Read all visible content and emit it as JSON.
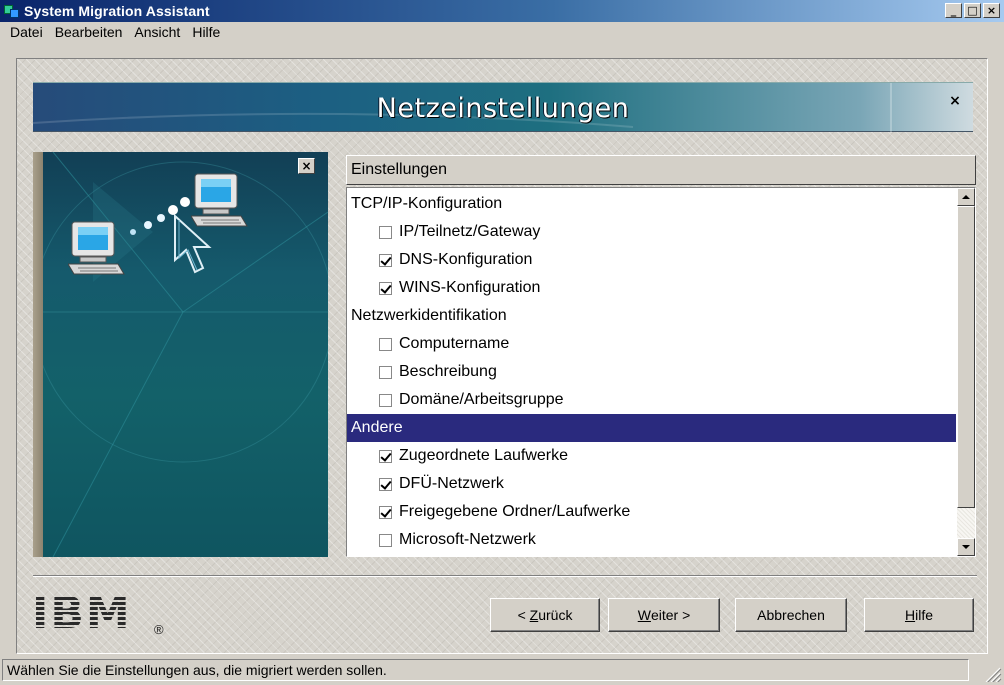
{
  "window": {
    "title": "System Migration Assistant",
    "controls": {
      "minimize": "_",
      "maximize": "□",
      "close": "×"
    }
  },
  "menu": [
    "Datei",
    "Bearbeiten",
    "Ansicht",
    "Hilfe"
  ],
  "banner": {
    "title": "Netzeinstellungen",
    "close": "×"
  },
  "side_panel": {
    "close": "×",
    "icons": [
      "computer-icon",
      "cursor-arrow-icon"
    ]
  },
  "settings": {
    "header": "Einstellungen",
    "groups": [
      {
        "label": "TCP/IP-Konfiguration",
        "selected": false,
        "items": [
          {
            "label": "IP/Teilnetz/Gateway",
            "checked": false
          },
          {
            "label": "DNS-Konfiguration",
            "checked": true
          },
          {
            "label": "WINS-Konfiguration",
            "checked": true
          }
        ]
      },
      {
        "label": "Netzwerkidentifikation",
        "selected": false,
        "items": [
          {
            "label": "Computername",
            "checked": false
          },
          {
            "label": "Beschreibung",
            "checked": false
          },
          {
            "label": "Domäne/Arbeitsgruppe",
            "checked": false
          }
        ]
      },
      {
        "label": "Andere",
        "selected": true,
        "items": [
          {
            "label": "Zugeordnete Laufwerke",
            "checked": true
          },
          {
            "label": "DFÜ-Netzwerk",
            "checked": true
          },
          {
            "label": "Freigegebene Ordner/Laufwerke",
            "checked": true
          },
          {
            "label": "Microsoft-Netzwerk",
            "checked": false
          }
        ]
      }
    ]
  },
  "logo": {
    "text": "IBM",
    "registered": "®"
  },
  "buttons": {
    "back": {
      "prefix": "< ",
      "mnemonic": "Z",
      "rest": "urück"
    },
    "next": {
      "mnemonic": "W",
      "rest": "eiter",
      "suffix": " >"
    },
    "cancel": "Abbrechen",
    "help": {
      "mnemonic": "H",
      "rest": "ilfe"
    }
  },
  "status": "Wählen Sie die Einstellungen aus, die migriert werden sollen.",
  "colors": {
    "selection": "#2a2a7e",
    "title_bar": "#0a246a",
    "panel": "#155a6c"
  }
}
